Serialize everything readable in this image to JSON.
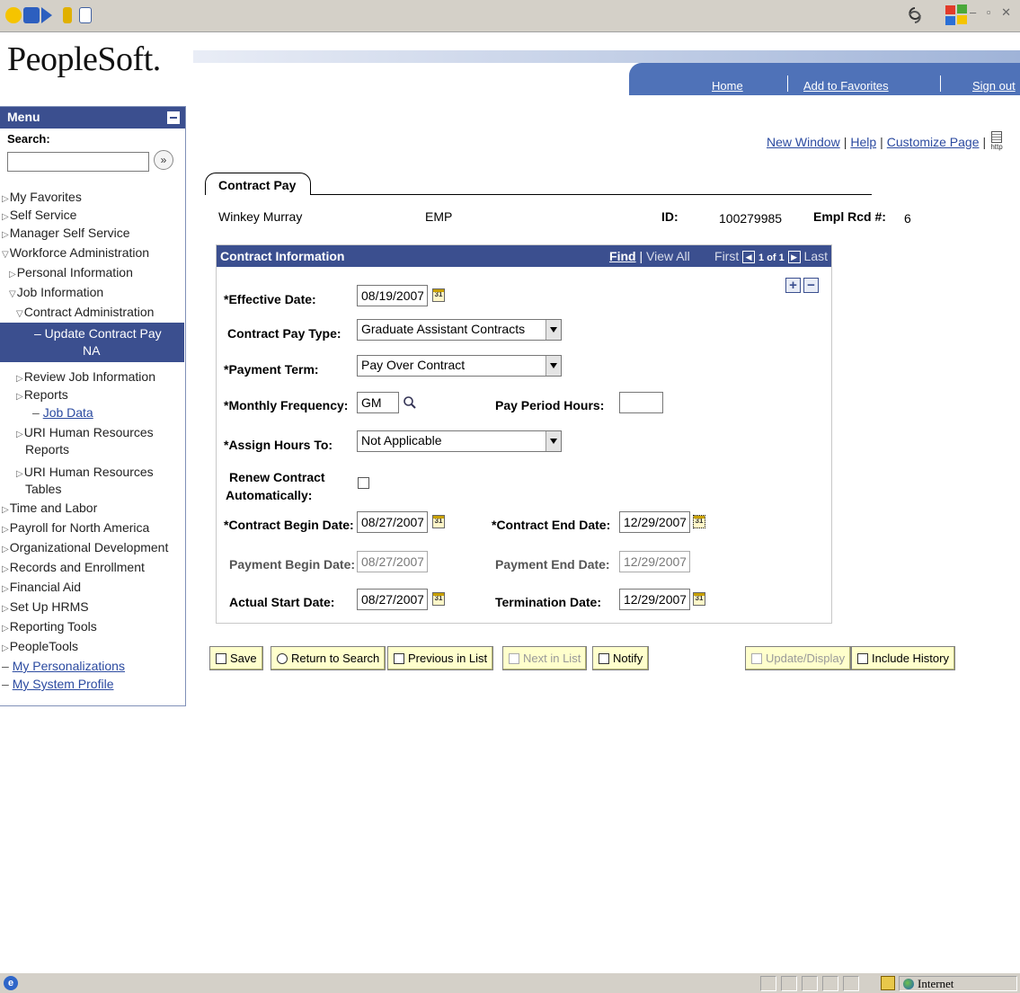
{
  "app": {
    "logo": "PeopleSoft.",
    "header_links": {
      "home": "Home",
      "favorites": "Add to Favorites",
      "signout": "Sign out"
    }
  },
  "browser": {
    "zone": "Internet"
  },
  "menu": {
    "title": "Menu",
    "search_label": "Search:",
    "search_value": "",
    "items": [
      "My Favorites",
      "Self Service",
      "Manager Self Service",
      "Workforce Administration",
      "Personal Information",
      "Job Information",
      "Contract Administration",
      "Update Contract Pay NA",
      "Review Job Information",
      "Reports",
      "Job Data",
      "URI Human Resources Reports",
      "URI Human Resources Tables",
      "Time and Labor",
      "Payroll for North America",
      "Organizational Development",
      "Records and Enrollment",
      "Financial Aid",
      "Set Up HRMS",
      "Reporting Tools",
      "PeopleTools",
      "My Personalizations",
      "My System Profile"
    ],
    "selected_line1": "– Update Contract Pay",
    "selected_line2": "NA",
    "urihr_reports_1": "URI Human Resources",
    "urihr_reports_2": "Reports",
    "urihr_tables_1": "URI Human Resources",
    "urihr_tables_2": "Tables"
  },
  "page_links": {
    "new_window": "New Window",
    "help": "Help",
    "customize": "Customize Page",
    "http": "http"
  },
  "tab": {
    "label": "Contract Pay"
  },
  "employee": {
    "name": "Winkey Murray",
    "type": "EMP",
    "id_label": "ID:",
    "id": "100279985",
    "rcd_label": "Empl Rcd #:",
    "rcd": "6"
  },
  "group": {
    "title": "Contract Information",
    "find": "Find",
    "view_all": "View All",
    "first": "First",
    "count": "1 of 1",
    "last": "Last"
  },
  "form": {
    "effective_date_label": "*Effective Date:",
    "effective_date": "08/19/2007",
    "contract_pay_type_label": "Contract Pay Type:",
    "contract_pay_type": "Graduate Assistant Contracts",
    "payment_term_label": "*Payment Term:",
    "payment_term": "Pay Over Contract",
    "monthly_frequency_label": "*Monthly Frequency:",
    "monthly_frequency": "GM",
    "pay_period_hours_label": "Pay Period Hours:",
    "pay_period_hours": "",
    "assign_hours_label": "*Assign Hours To:",
    "assign_hours": "Not Applicable",
    "renew_label_1": "Renew Contract",
    "renew_label_2": "Automatically:",
    "contract_begin_label": "*Contract Begin Date:",
    "contract_begin": "08/27/2007",
    "contract_end_label": "*Contract End Date:",
    "contract_end": "12/29/2007",
    "payment_begin_label": "Payment Begin Date:",
    "payment_begin": "08/27/2007",
    "payment_end_label": "Payment End Date:",
    "payment_end": "12/29/2007",
    "actual_start_label": "Actual Start Date:",
    "actual_start": "08/27/2007",
    "termination_label": "Termination Date:",
    "termination": "12/29/2007",
    "calendar_glyph": "31"
  },
  "buttons": {
    "save": "Save",
    "return_to_search": "Return to Search",
    "previous_in_list": "Previous in List",
    "next_in_list": "Next in List",
    "notify": "Notify",
    "update_display": "Update/Display",
    "include_history": "Include History"
  },
  "colors": {
    "primary": "#3b4f8f",
    "header_bar": "#4f72b8",
    "button_bg": "#ffffcc",
    "link": "#2b4aa0"
  }
}
